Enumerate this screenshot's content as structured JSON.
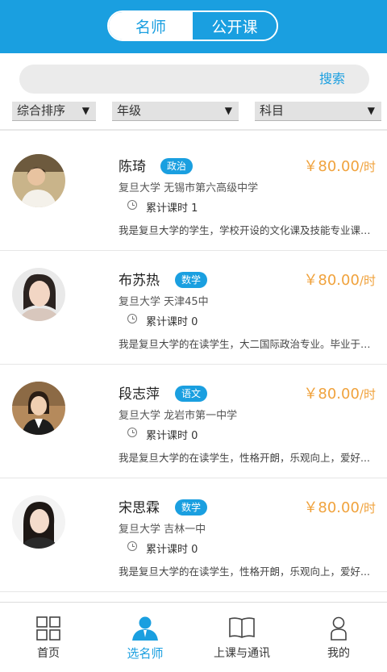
{
  "header": {
    "tabs": [
      {
        "label": "名师",
        "active": true
      },
      {
        "label": "公开课",
        "active": false
      }
    ]
  },
  "search": {
    "button_label": "搜索"
  },
  "filters": {
    "sort": "综合排序",
    "grade": "年级",
    "subject": "科目",
    "arrow": "▼"
  },
  "teachers": [
    {
      "name": "陈琦",
      "subject": "政治",
      "price": "￥80.00",
      "unit": "/时",
      "school": "复旦大学 无锡市第六高级中学",
      "hours": "累计课时 1",
      "intro": "我是复旦大学的学生，学校开设的文化课及技能专业课程..."
    },
    {
      "name": "布苏热",
      "subject": "数学",
      "price": "￥80.00",
      "unit": "/时",
      "school": "复旦大学 天津45中",
      "hours": "累计课时 0",
      "intro": "我是复旦大学的在读学生，大二国际政治专业。毕业于天津..."
    },
    {
      "name": "段志萍",
      "subject": "语文",
      "price": "￥80.00",
      "unit": "/时",
      "school": "复旦大学 龙岩市第一中学",
      "hours": "累计课时 0",
      "intro": "我是复旦大学的在读学生，性格开朗，乐观向上，爱好..."
    },
    {
      "name": "宋思霖",
      "subject": "数学",
      "price": "￥80.00",
      "unit": "/时",
      "school": "复旦大学 吉林一中",
      "hours": "累计课时 0",
      "intro": "我是复旦大学的在读学生，性格开朗，乐观向上，爱好..."
    }
  ],
  "bottom_nav": [
    {
      "label": "首页",
      "icon": "grid-icon",
      "active": false
    },
    {
      "label": "选名师",
      "icon": "teacher-icon",
      "active": true
    },
    {
      "label": "上课与通讯",
      "icon": "book-icon",
      "active": false
    },
    {
      "label": "我的",
      "icon": "person-icon",
      "active": false
    }
  ],
  "colors": {
    "accent": "#1a9fe0",
    "price": "#f0a23c"
  }
}
